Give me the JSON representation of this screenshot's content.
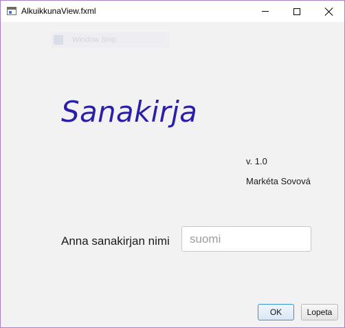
{
  "window": {
    "title": "AlkuikkunaView.fxml"
  },
  "snap_overlay": {
    "label": "Window Snip"
  },
  "main": {
    "app_title": "Sanakirja",
    "version": "v. 1.0",
    "author": "Markéta Sovová",
    "prompt_label": "Anna sanakirjan nimi",
    "name_input": {
      "value": "",
      "placeholder": "suomi"
    }
  },
  "buttons": {
    "ok_label": "OK",
    "quit_label": "Lopeta"
  },
  "colors": {
    "title_accent": "#2a1fa8",
    "default_button_border": "#3a8fd6",
    "window_border": "#a77fc9"
  }
}
